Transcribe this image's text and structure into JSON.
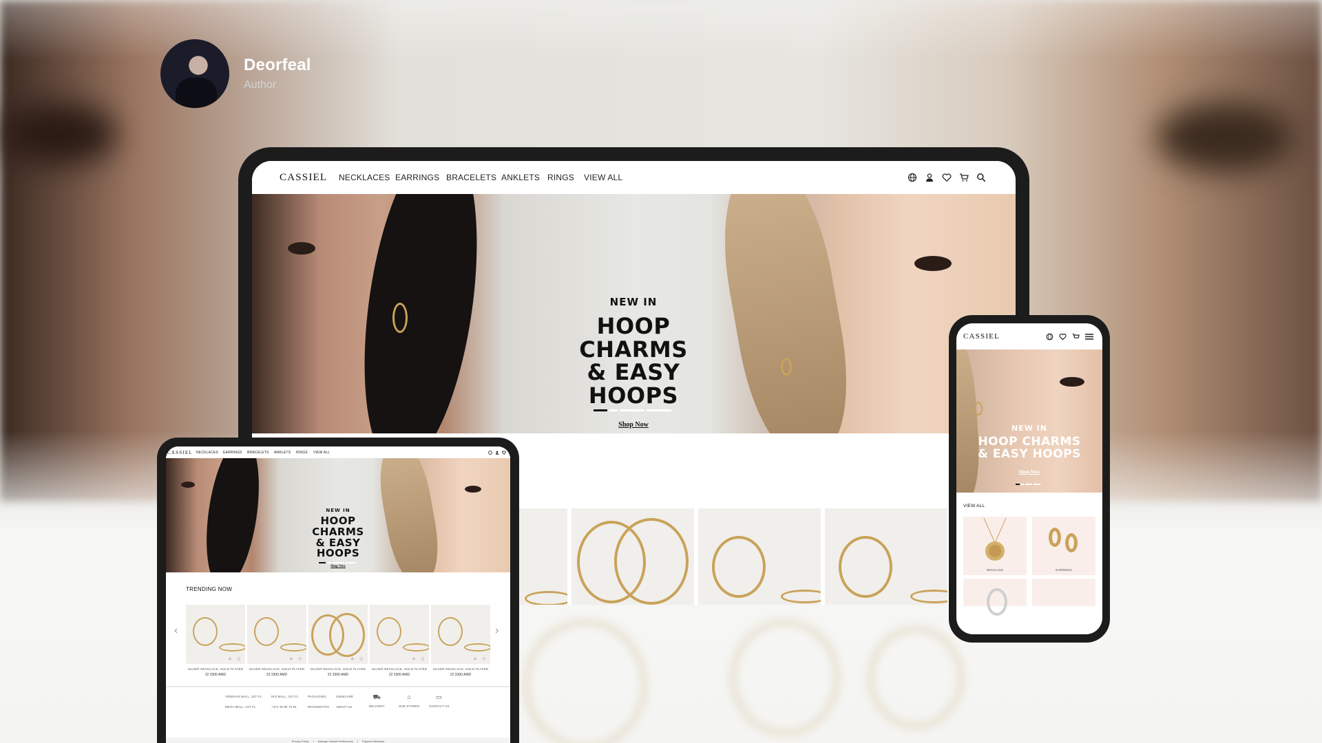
{
  "author": {
    "name": "Deorfeal",
    "role": "Author"
  },
  "brand": {
    "logo": "CASSIEL",
    "accent": "#111111",
    "gold": "#c9a35a"
  },
  "nav": {
    "items": [
      "NECKLACES",
      "EARRINGS",
      "BRACELETS",
      "ANKLETS",
      "RINGS",
      "VIEW ALL"
    ],
    "icons": [
      "globe-icon",
      "user-icon",
      "heart-icon",
      "cart-icon",
      "search-icon"
    ]
  },
  "hero": {
    "kicker": "NEW IN",
    "title_line1": "HOOP CHARMS",
    "title_line2": "& EASY HOOPS",
    "cta": "Shop Now",
    "slides": 4,
    "active_slide": 1
  },
  "tablet": {
    "trending_title": "TRENDING NOW",
    "products": [
      {
        "name": "SILVER NECKLACE, GOLD PLATED",
        "price": "22 3300 AMD"
      },
      {
        "name": "SILVER NECKLACE, GOLD PLATED",
        "price": "22 3300 AMD"
      },
      {
        "name": "SILVER NECKLACE, GOLD PLATED",
        "price": "22 3300 AMD"
      },
      {
        "name": "SILVER NECKLACE, GOLD PLATED",
        "price": "22 3300 AMD"
      },
      {
        "name": "SILVER NECKLACE, GOLD PLATED",
        "price": "22 3300 AMD"
      }
    ],
    "footer": {
      "stores_line1": [
        "YEREVAN MALL, 1ST FL",
        "RIO MALL, 1ST FL"
      ],
      "stores_line2": [
        "MEGA MALL, 1ST FL",
        "+374 45 80 75 84"
      ],
      "links_line1": [
        "PACKAGING",
        "USE&CARE"
      ],
      "links_line2": [
        "WHISHMATCH",
        "ABOUT US"
      ],
      "services": [
        "DELIVERY",
        "OUR STORES",
        "CONTACT US"
      ],
      "legal": [
        "Privacy Policy",
        "Manage Cassiel Preferences",
        "Payment Methods"
      ]
    }
  },
  "phone": {
    "view_all": "VIEW ALL",
    "categories": [
      "NECKLACE",
      "EARRINGS"
    ]
  }
}
